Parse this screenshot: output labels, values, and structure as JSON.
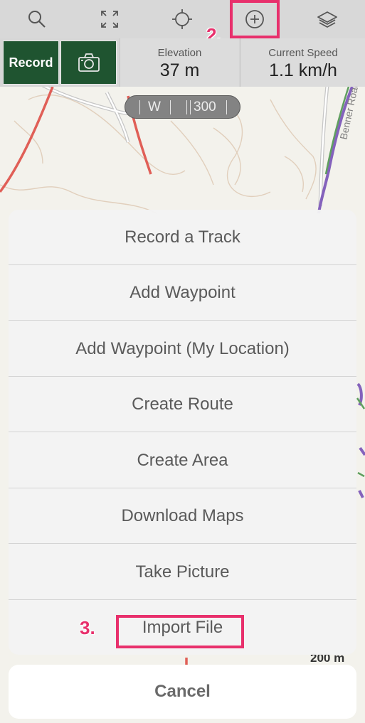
{
  "toolbar": {
    "icons": [
      "search-icon",
      "fullscreen-icon",
      "crosshair-icon",
      "add-circle-icon",
      "layers-icon"
    ]
  },
  "annotations": {
    "step2": "2.",
    "step3": "3."
  },
  "status": {
    "record_label": "Record",
    "elevation_label": "Elevation",
    "elevation_value": "37 m",
    "speed_label": "Current Speed",
    "speed_value": "1.1 km/h"
  },
  "compass": {
    "heading": "W",
    "degrees": "300"
  },
  "map": {
    "road_label": "Benner Road",
    "scale_label": "200 m"
  },
  "sheet": {
    "items": [
      "Record a Track",
      "Add Waypoint",
      "Add Waypoint (My Location)",
      "Create Route",
      "Create Area",
      "Download Maps",
      "Take Picture",
      "Import File"
    ],
    "cancel": "Cancel"
  },
  "colors": {
    "accent_highlight": "#e8306c",
    "record_green": "#1f5430",
    "track_red": "#d62a1f",
    "track_purple": "#5b2ea6"
  }
}
